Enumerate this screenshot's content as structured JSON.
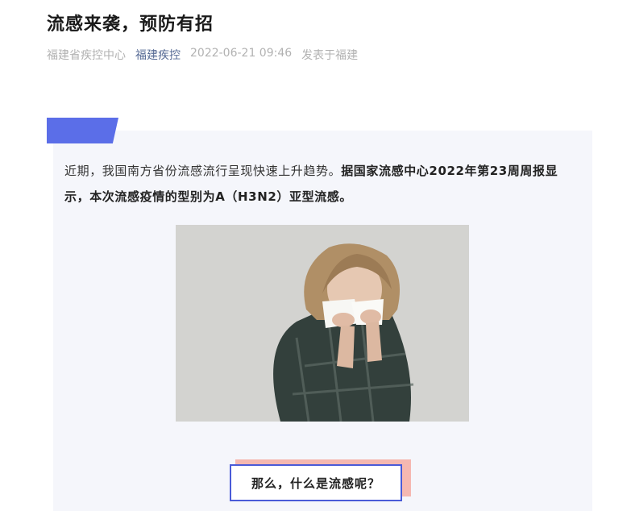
{
  "article": {
    "title": "流感来袭，预防有招",
    "author": "福建省疾控中心",
    "account": "福建疾控",
    "date": "2022-06-21 09:46",
    "location": "发表于福建"
  },
  "content": {
    "intro_normal": "近期，我国南方省份流感流行呈现快速上升趋势。",
    "intro_bold": "据国家流感中心2022年第23周周报显示，本次流感疫情的型别为A（H3N2）亚型流感。",
    "question": "那么，什么是流感呢？"
  },
  "colors": {
    "accent": "#5b6ee8",
    "card_bg": "#f5f6fb",
    "shadow": "#f5b8b1",
    "account_link": "#576b95"
  }
}
